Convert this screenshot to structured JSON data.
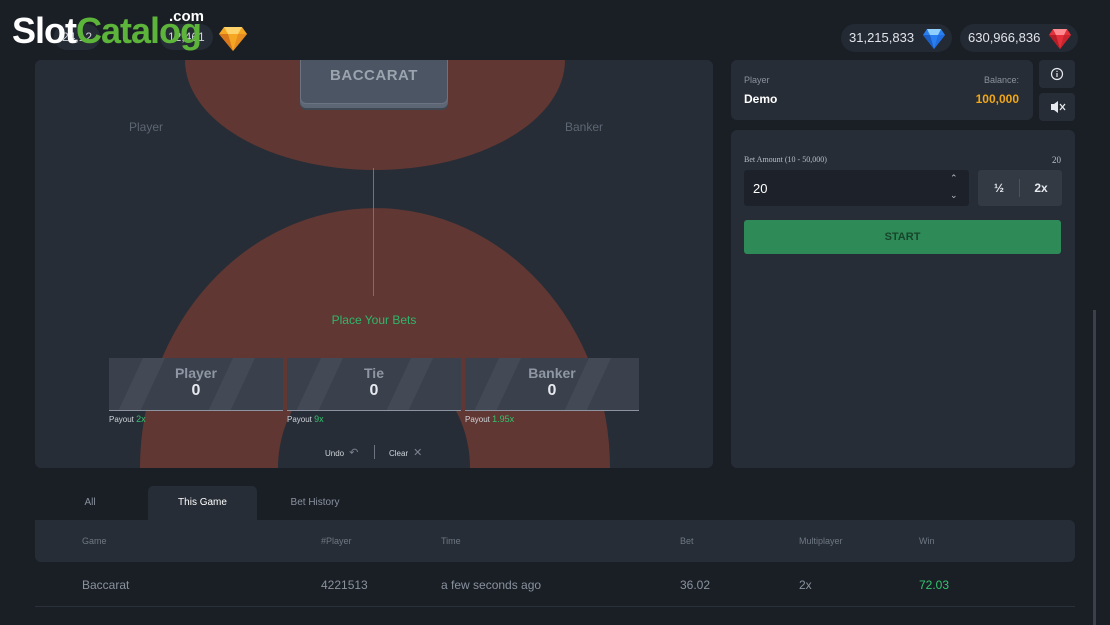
{
  "logo": {
    "slot": "Slot",
    "catalog": "Catalog",
    "com": ".com"
  },
  "logo_pills": [
    "24,12",
    "12,461"
  ],
  "wallets": [
    {
      "amount": "31,215,833",
      "gem": "blue-gem",
      "color": "#2a7ff0"
    },
    {
      "amount": "630,966,836",
      "gem": "red-gem",
      "color": "#e3303a"
    }
  ],
  "table": {
    "shoe_label": "BACCARAT",
    "player_label": "Player",
    "banker_label": "Banker",
    "place_bets": "Place Your Bets",
    "bets": [
      {
        "name": "Player",
        "value": "0",
        "payout_label": "Payout",
        "payout": "2x"
      },
      {
        "name": "Tie",
        "value": "0",
        "payout_label": "Payout",
        "payout": "9x"
      },
      {
        "name": "Banker",
        "value": "0",
        "payout_label": "Payout",
        "payout": "1.95x"
      }
    ],
    "undo": "Undo",
    "clear": "Clear"
  },
  "player_panel": {
    "player_label": "Player",
    "player_name": "Demo",
    "balance_label": "Balance:",
    "balance": "100,000"
  },
  "bet_panel": {
    "amount_label": "Bet Amount (10 - 50,000)",
    "amount_right": "20",
    "amount_value": "20",
    "half": "½",
    "double": "2x",
    "start": "START"
  },
  "tabs": [
    {
      "label": "All",
      "active": false
    },
    {
      "label": "This Game",
      "active": true
    },
    {
      "label": "Bet History",
      "active": false
    }
  ],
  "history": {
    "headers": [
      "Game",
      "#Player",
      "Time",
      "Bet",
      "Multiplayer",
      "Win"
    ],
    "rows": [
      [
        "Baccarat",
        "4221513",
        "a few seconds ago",
        "36.02",
        "2x",
        "72.03"
      ]
    ]
  },
  "colors": {
    "accent_green": "#2fb76a",
    "start_green": "#2e8b57",
    "balance_orange": "#f0a718",
    "arc_brown": "#7a3f35"
  }
}
